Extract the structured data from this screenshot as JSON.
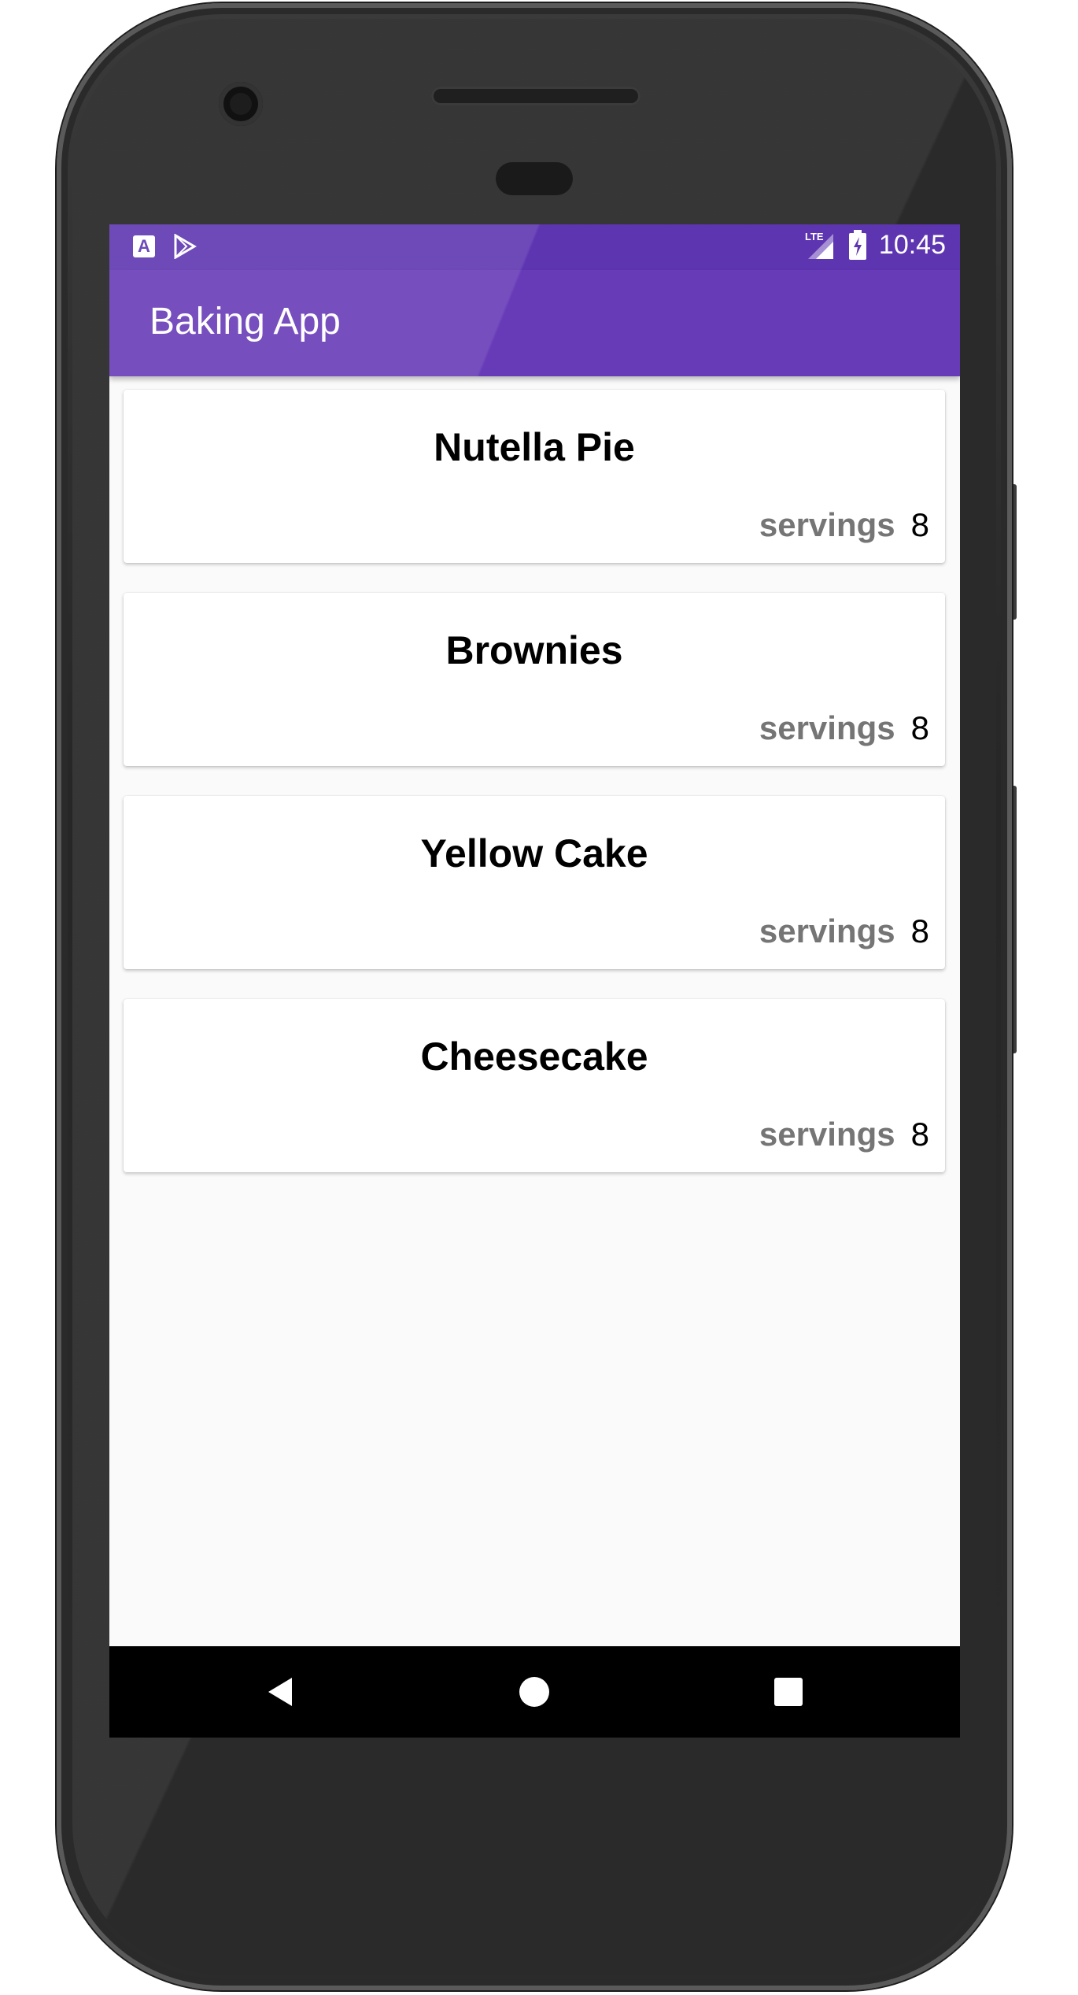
{
  "status_bar": {
    "time": "10:45",
    "network": "LTE",
    "icons": [
      "a-notification-icon",
      "play-store-icon",
      "lte-signal-icon",
      "battery-charging-icon"
    ]
  },
  "app_bar": {
    "title": "Baking App"
  },
  "recipes": [
    {
      "name": "Nutella Pie",
      "servings_label": "servings",
      "servings": "8"
    },
    {
      "name": "Brownies",
      "servings_label": "servings",
      "servings": "8"
    },
    {
      "name": "Yellow Cake",
      "servings_label": "servings",
      "servings": "8"
    },
    {
      "name": "Cheesecake",
      "servings_label": "servings",
      "servings": "8"
    }
  ],
  "nav_bar": {
    "buttons": [
      "back-icon",
      "home-icon",
      "recents-icon"
    ]
  },
  "colors": {
    "primary": "#673ab7",
    "primary_dark": "#5e35b1",
    "servings_label": "#757575",
    "background": "#fafafa"
  }
}
